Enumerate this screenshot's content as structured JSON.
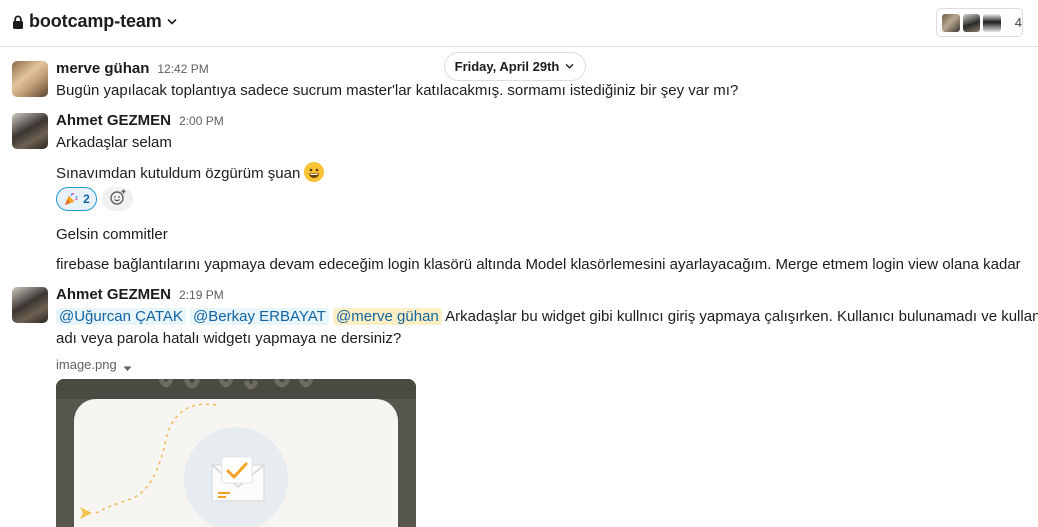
{
  "header": {
    "channel_name": "bootcamp-team",
    "member_count": "4"
  },
  "date_divider": "Friday, April 29th",
  "messages": [
    {
      "author": "merve gühan",
      "time": "12:42 PM",
      "lines": [
        "Bugün yapılacak toplantıya sadece sucrum master'lar katılacakmış. sormamı istediğiniz bir şey var mı?"
      ]
    },
    {
      "author": "Ahmet GEZMEN",
      "time": "2:00 PM",
      "lines": [
        "Arkadaşlar selam",
        "Sınavımdan kutuldum özgürüm şuan",
        "Gelsin commitler",
        "firebase bağlantılarını yapmaya devam edeceğim login klasörü altında Model klasörlemesini ayarlayacağım. Merge etmem login view olana kadar"
      ],
      "reaction": {
        "icon": "party-popper-icon",
        "count": "2"
      }
    },
    {
      "author": "Ahmet GEZMEN",
      "time": "2:19 PM",
      "mentions": [
        "@Uğurcan ÇATAK",
        "@Berkay ERBAYAT",
        "@merve gühan"
      ],
      "text_after_mentions": "Arkadaşlar bu widget gibi kullnıcı giriş yapmaya çalışırken. Kullanıcı bulunamadı ve kullanıcı",
      "text_line2": "adı veya parola hatalı widgetı yapmaya ne dersiniz?",
      "file_name": "image.png"
    }
  ],
  "colors": {
    "mention_bg": "#e8f5fa",
    "mention_self_bg": "#fcefc5",
    "link": "#1264a3",
    "reaction_border": "#1d9bd1"
  }
}
